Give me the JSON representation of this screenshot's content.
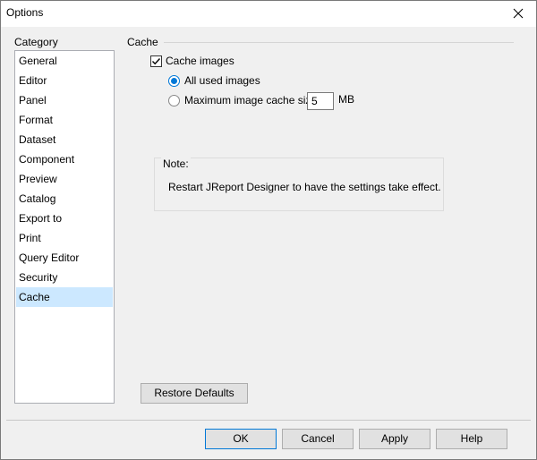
{
  "window": {
    "title": "Options",
    "close_glyph": "✕"
  },
  "category": {
    "label": "Category",
    "items": [
      {
        "label": "General"
      },
      {
        "label": "Editor"
      },
      {
        "label": "Panel"
      },
      {
        "label": "Format"
      },
      {
        "label": "Dataset"
      },
      {
        "label": "Component"
      },
      {
        "label": "Preview"
      },
      {
        "label": "Catalog"
      },
      {
        "label": "Export to"
      },
      {
        "label": "Print"
      },
      {
        "label": "Query Editor"
      },
      {
        "label": "Security"
      },
      {
        "label": "Cache"
      }
    ],
    "selected": "Cache"
  },
  "cache": {
    "section_title": "Cache",
    "cache_images_label": "Cache images",
    "cache_images_checked": true,
    "all_used_label": "All used images",
    "max_size_label": "Maximum image cache size:",
    "max_size_value": "5",
    "unit_label": "MB",
    "selected_option": "All used images"
  },
  "note": {
    "title": "Note:",
    "text": "Restart JReport Designer to have the settings take effect."
  },
  "buttons": {
    "restore": "Restore Defaults",
    "ok": "OK",
    "cancel": "Cancel",
    "apply": "Apply",
    "help": "Help"
  },
  "colors": {
    "selection": "#cce8ff",
    "accent": "#0078d7",
    "dialog_bg": "#f0f0f0"
  },
  "icons": {
    "close": "close-icon",
    "check": "checkmark-icon"
  }
}
